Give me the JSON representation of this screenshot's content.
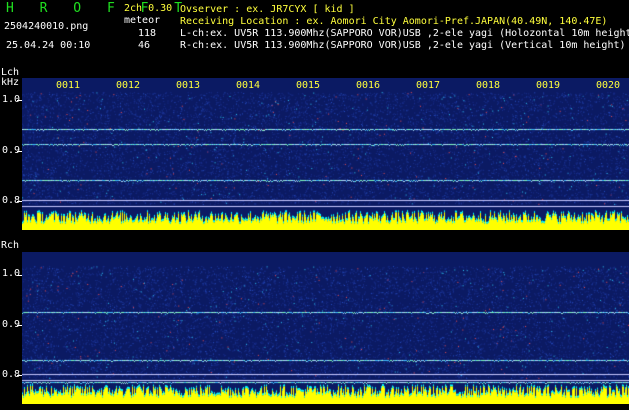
{
  "header": {
    "brand": "H R O F F T",
    "version": "2ch 0.30",
    "meteor_label": "meteor",
    "filename": "2504240010.png",
    "datetime": "25.04.24 00:10",
    "count_l": "118",
    "count_r": "46",
    "observer": "Ovserver              : ex. JR7CYX [ kid ]",
    "location": "Receiving Location : ex. Aomori City Aomori-Pref.JAPAN(40.49N, 140.47E)",
    "lch_info": "L-ch:ex. UV5R 113.900Mhz(SAPPORO VOR)USB ,2-ele yagi (Holozontal 10m height",
    "rch_info": "R-ch:ex. UV5R 113.900Mhz(SAPPORO VOR)USB ,2-ele yagi (Vertical 10m height)"
  },
  "lch": {
    "label": "Lch",
    "unit": "kHz",
    "y_ticks": [
      "1.0",
      "0.9",
      "0.8"
    ],
    "time_ticks": [
      "0011",
      "0012",
      "0013",
      "0014",
      "0015",
      "0016",
      "0017",
      "0018",
      "0019",
      "0020"
    ]
  },
  "rch": {
    "label": "Rch",
    "y_ticks": [
      "1.0",
      "0.9",
      "0.8"
    ]
  },
  "colors": {
    "background": "#000000",
    "panel": "#0b1a63",
    "accent_green": "#20e020",
    "tick_yellow": "#ffff3c",
    "level_yellow": "#ffff00",
    "level_cyan": "#00ffff"
  }
}
